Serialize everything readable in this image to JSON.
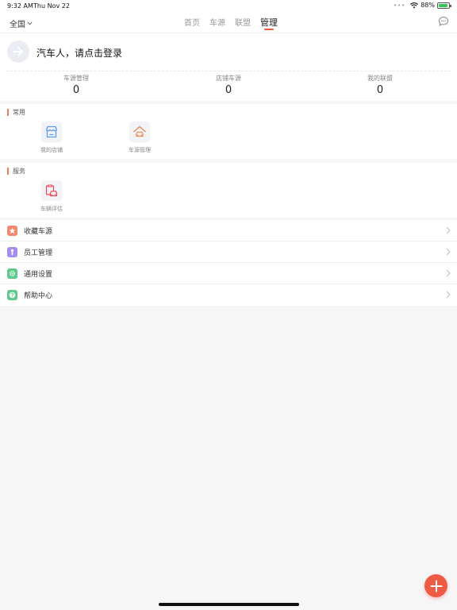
{
  "status_bar": {
    "time": "9:32 AM",
    "date": "Thu Nov 22",
    "battery": "88%",
    "battery_level": 0.88
  },
  "navbar": {
    "region": "全国",
    "tabs": [
      {
        "label": "首页",
        "active": false
      },
      {
        "label": "车源",
        "active": false
      },
      {
        "label": "联盟",
        "active": false
      },
      {
        "label": "管理",
        "active": true
      }
    ],
    "icons": {
      "region_dropdown": "chevron-down-icon",
      "messages": "chat-bubble-icon"
    }
  },
  "login": {
    "text": "汽车人，请点击登录",
    "stats": [
      {
        "label": "车源管理",
        "value": "0"
      },
      {
        "label": "店铺车源",
        "value": "0"
      },
      {
        "label": "我的联盟",
        "value": "0"
      }
    ]
  },
  "sections": {
    "common": {
      "title": "常用",
      "items": [
        {
          "label": "我的店铺",
          "icon": "storefront-icon",
          "color": "#5b9bf0"
        },
        {
          "label": "车源管理",
          "icon": "car-house-icon",
          "color": "#f0874a"
        }
      ]
    },
    "service": {
      "title": "服务",
      "items": [
        {
          "label": "车辆评估",
          "icon": "car-evaluation-icon",
          "color": "#e9485b"
        }
      ]
    }
  },
  "menu": [
    {
      "label": "收藏车源",
      "icon": "star-icon",
      "color": "#f48770"
    },
    {
      "label": "员工管理",
      "icon": "person-icon",
      "color": "#a58cf0"
    },
    {
      "label": "通用设置",
      "icon": "gear-icon",
      "color": "#5ecb8d"
    },
    {
      "label": "帮助中心",
      "icon": "question-icon",
      "color": "#5ecb8d"
    }
  ],
  "fab": {
    "icon": "plus-icon",
    "color": "#ef5a45"
  }
}
